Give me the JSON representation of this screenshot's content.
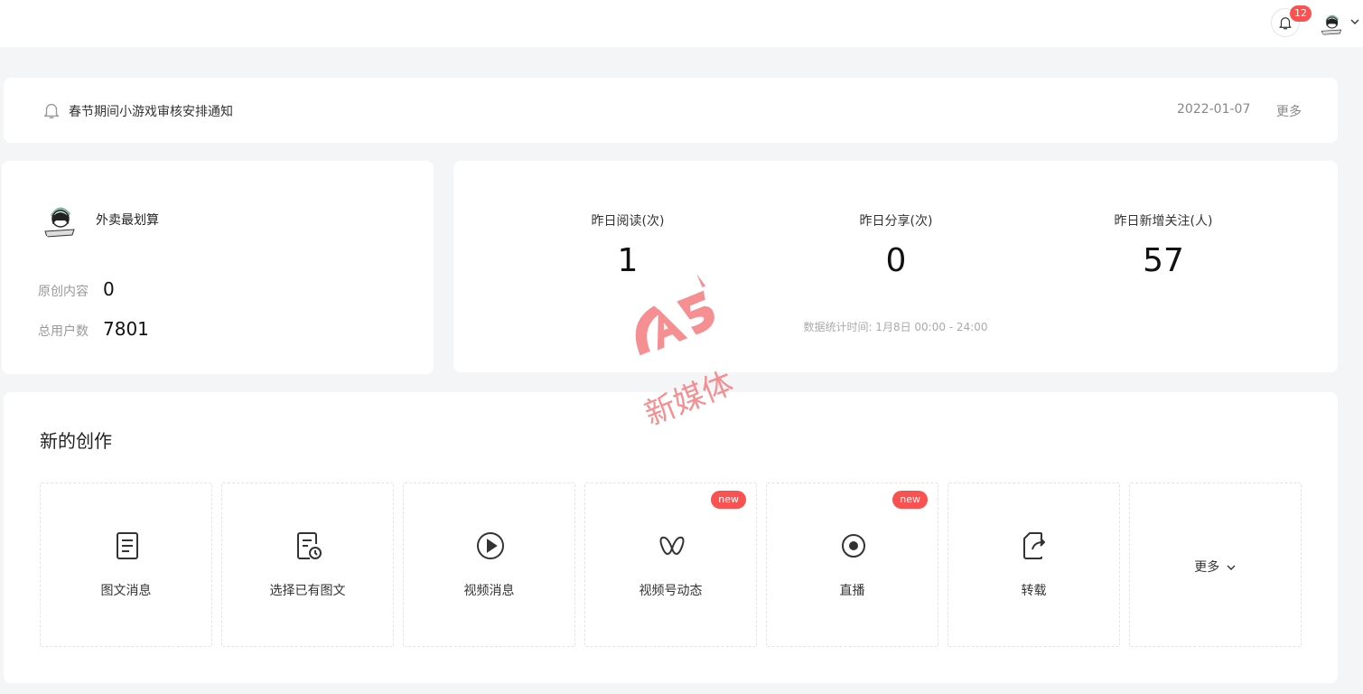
{
  "header": {
    "notification_count": "12"
  },
  "notice": {
    "title": "春节期间小游戏审核安排通知",
    "date": "2022-01-07",
    "more_label": "更多"
  },
  "account": {
    "name": "外卖最划算",
    "original_label": "原创内容",
    "original_value": "0",
    "users_label": "总用户数",
    "users_value": "7801"
  },
  "stats": {
    "items": [
      {
        "label": "昨日阅读(次)",
        "value": "1"
      },
      {
        "label": "昨日分享(次)",
        "value": "0"
      },
      {
        "label": "昨日新增关注(人)",
        "value": "57"
      }
    ],
    "footnote": "数据统计时间: 1月8日 00:00 - 24:00"
  },
  "create": {
    "heading": "新的创作",
    "tiles": [
      {
        "label": "图文消息",
        "icon": "document-icon"
      },
      {
        "label": "选择已有图文",
        "icon": "document-clock-icon"
      },
      {
        "label": "视频消息",
        "icon": "play-circle-icon"
      },
      {
        "label": "视频号动态",
        "icon": "butterfly-icon",
        "badge": "new"
      },
      {
        "label": "直播",
        "icon": "record-icon",
        "badge": "new"
      },
      {
        "label": "转载",
        "icon": "share-doc-icon"
      }
    ],
    "more_label": "更多"
  },
  "watermark": {
    "logo_text": "A5",
    "caption": "新媒体"
  },
  "colors": {
    "badge": "#fa5151",
    "background": "#f4f5f7",
    "watermark": "#f47c80"
  }
}
